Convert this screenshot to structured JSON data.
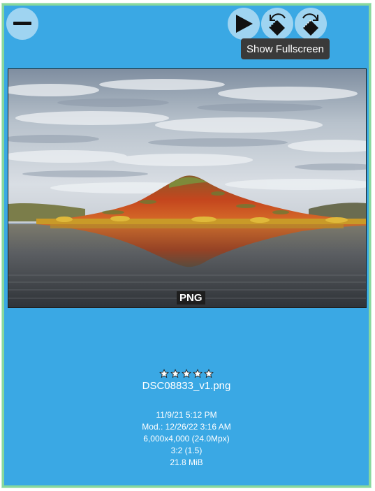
{
  "toolbar": {
    "collapse_icon": "minus-icon",
    "play_icon": "play-icon",
    "prev_icon": "rotate-left-icon",
    "next_icon": "rotate-right-icon",
    "tooltip": "Show Fullscreen"
  },
  "image": {
    "format_badge": "PNG",
    "filename": "DSC08833_v1.png",
    "rating": 0,
    "rating_max": 5,
    "date": "11/9/21 5:12 PM",
    "modified": "Mod.: 12/26/22 3:16 AM",
    "dimensions": "6,000x4,000 (24.0Mpx)",
    "aspect_ratio": "3:2 (1.5)",
    "file_size": "21.8 MiB"
  },
  "colors": {
    "card_background": "#3aa8e4",
    "card_border": "#88d89c",
    "button_background": "#9fd4f1",
    "tooltip_background": "#3a3a3a"
  }
}
